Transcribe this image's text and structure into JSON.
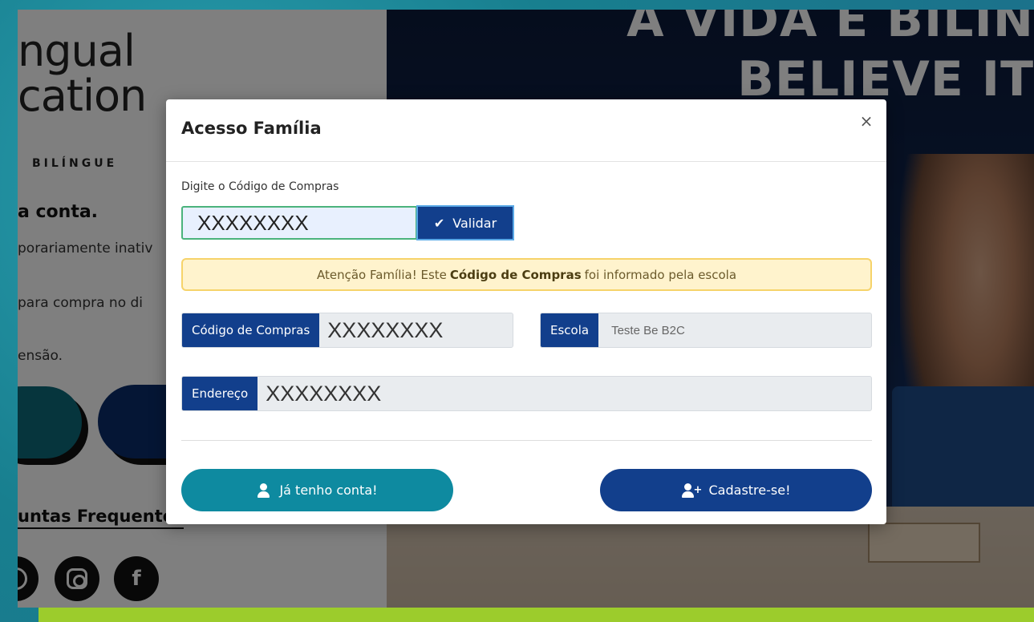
{
  "background": {
    "brand_line1": "ngual",
    "brand_line2": "cation",
    "tagline": "BILÍNGUE",
    "conta": "a conta.",
    "line1": "porariamente inativ",
    "line2": "para compra no di",
    "line3": "ensão.",
    "faq": "untas Frequentes",
    "hero_line1": "A VIDA É BILIN",
    "hero_line2": "BELIEVE IT"
  },
  "modal": {
    "title": "Acesso Família",
    "close_label": "×",
    "code_label": "Digite o Código de Compras",
    "code_value": "XXXXXXXX",
    "validate_label": "Validar",
    "alert": {
      "prefix": "Atenção Família! Este",
      "highlight": "Código de Compras",
      "suffix": "foi informado pela escola"
    },
    "fields": {
      "code_label": "Código de Compras",
      "code_value": "XXXXXXXX",
      "school_label": "Escola",
      "school_value": "Teste Be B2C",
      "address_label": "Endereço",
      "address_value": "XXXXXXXX"
    },
    "have_account_label": "Já tenho conta!",
    "signup_label": "Cadastre-se!"
  },
  "icons": {
    "check": "double-check-icon",
    "user": "user-icon",
    "user_plus": "user-plus-icon"
  },
  "colors": {
    "primary": "#123f8c",
    "teal": "#0e8aa0",
    "alert_bg": "#fff3cd",
    "alert_border": "#f6d36a",
    "input_border": "#4bb37c",
    "frame_bottom": "#9ccc2c"
  }
}
